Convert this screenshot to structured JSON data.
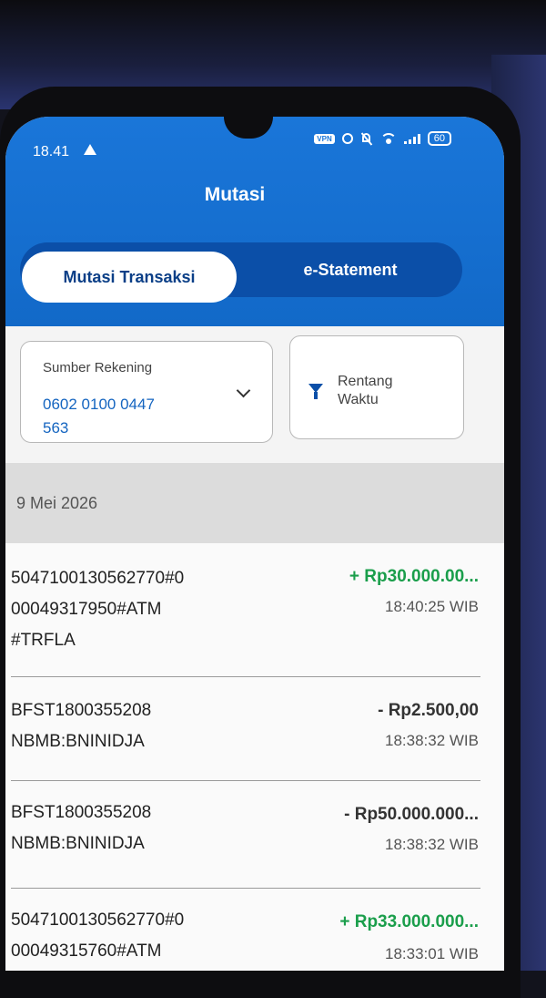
{
  "status_bar": {
    "time": "18.41",
    "vpn": "VPN",
    "battery": "60"
  },
  "header": {
    "title": "Mutasi"
  },
  "tabs": [
    {
      "label": "Mutasi Transaksi",
      "active": true
    },
    {
      "label": "e-Statement",
      "active": false
    }
  ],
  "filters": {
    "source_label": "Sumber Rekening",
    "source_value_line1": "0602 0100 0447",
    "source_value_line2": "563",
    "range_line1": "Rentang",
    "range_line2": "Waktu"
  },
  "date_header": "9 Mei 2026",
  "transactions": [
    {
      "desc": [
        "5047100130562770#0",
        "00049317950#ATM",
        "#TRFLA"
      ],
      "amount": "+ Rp30.000.00...",
      "time": "18:40:25 WIB",
      "type": "credit"
    },
    {
      "desc": [
        "BFST1800355208",
        "NBMB:BNINIDJA"
      ],
      "amount": "- Rp2.500,00",
      "time": "18:38:32 WIB",
      "type": "debit"
    },
    {
      "desc": [
        "BFST1800355208",
        "NBMB:BNINIDJA"
      ],
      "amount": "- Rp50.000.000...",
      "time": "18:38:32 WIB",
      "type": "debit"
    },
    {
      "desc": [
        "5047100130562770#0",
        "00049315760#ATM"
      ],
      "amount": "+ Rp33.000.000...",
      "time": "18:33:01 WIB",
      "type": "credit"
    }
  ],
  "colors": {
    "header_blue": "#1a76d9",
    "segment_blue": "#0b4fa8",
    "credit_green": "#1a9e4b"
  }
}
